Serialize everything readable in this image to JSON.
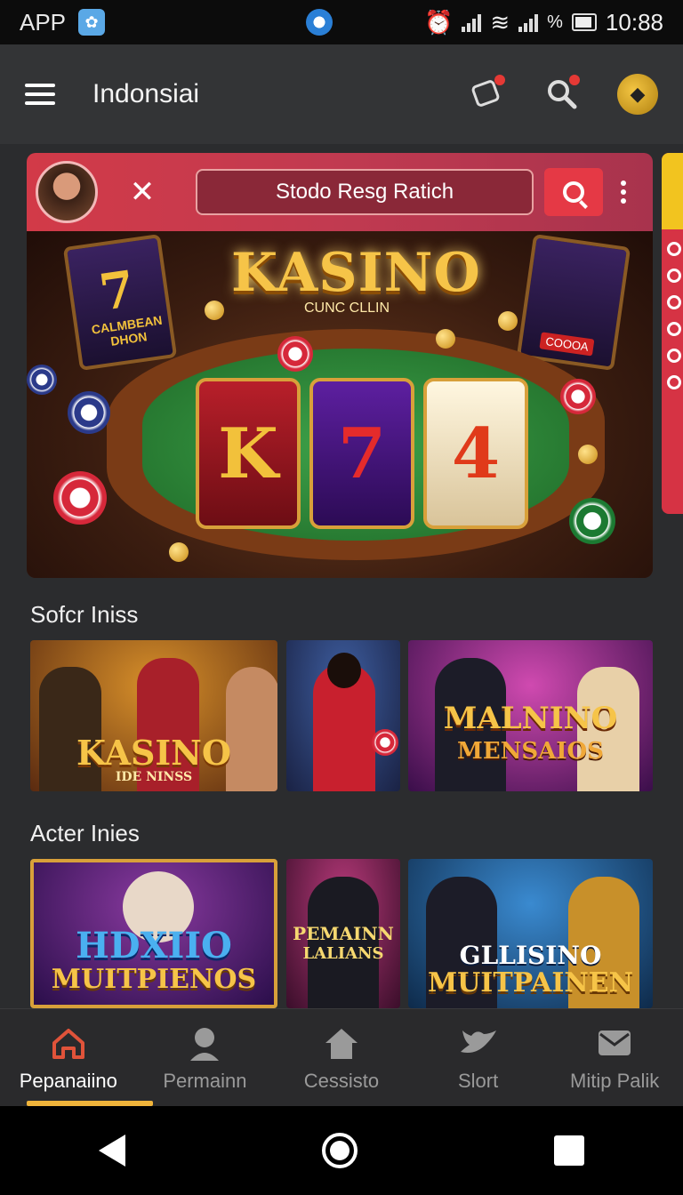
{
  "status_bar": {
    "app_label": "APP",
    "percent_symbol": "%",
    "time": "10:88"
  },
  "app_bar": {
    "title": "Indonsiai"
  },
  "banner": {
    "search_text": "Stodo Resg Ratich",
    "logo_title": "KASINO",
    "logo_subtitle": "CUNC CLLIN",
    "left_card_text": "CALMBEAN DHON",
    "right_card_text": "COOOA",
    "reels": [
      "K",
      "7",
      "4"
    ]
  },
  "sections": [
    {
      "title": "Sofcr Iniss",
      "tiles": [
        {
          "title": "KASINO",
          "subtitle": "IDE NINSS",
          "bg": "#7a4a1a"
        },
        {
          "title": "",
          "subtitle": "",
          "bg": "#2e3a66"
        },
        {
          "title": "MALNINO",
          "subtitle": "MENSAIOS",
          "bg": "#6a1a6a"
        }
      ]
    },
    {
      "title": "Acter Inies",
      "tiles": [
        {
          "title": "HDXIIO",
          "subtitle": "MUITPIENOS",
          "bg": "#3a1a5a"
        },
        {
          "title": "PEMAINN",
          "subtitle": "LALIANS",
          "bg": "#6a1a3a"
        },
        {
          "title": "GLLISINO",
          "subtitle": "MUITPAINEN",
          "bg": "#1e4a7a"
        }
      ]
    }
  ],
  "bottom_nav": [
    {
      "label": "Pepanaiino",
      "icon": "home-icon",
      "active": true
    },
    {
      "label": "Permainn",
      "icon": "person-icon",
      "active": false
    },
    {
      "label": "Cessisto",
      "icon": "house-icon",
      "active": false
    },
    {
      "label": "Slort",
      "icon": "bird-icon",
      "active": false
    },
    {
      "label": "Mitip Palik",
      "icon": "mail-icon",
      "active": false
    }
  ],
  "colors": {
    "accent": "#e53945",
    "nav_active_indicator": "#f0b43a",
    "background": "#2b2c2e"
  }
}
